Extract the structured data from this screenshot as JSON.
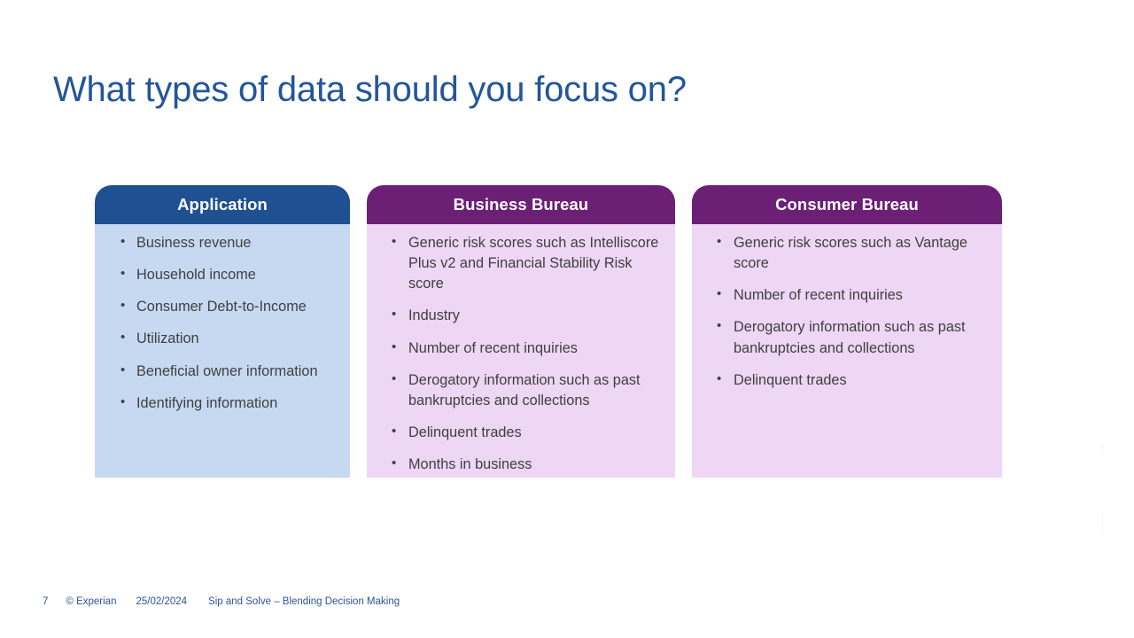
{
  "slide": {
    "title": "What types of data should you focus on?",
    "background": "#FFFFFF",
    "title_color": "#22559C"
  },
  "cards": [
    {
      "id": "application",
      "header": "Application",
      "header_color": "#1F5091",
      "body_color": "#C6D9F1",
      "bullets": [
        "Business revenue",
        "Household income",
        "Consumer Debt-to-Income",
        "Utilization",
        "Beneficial owner information",
        "Identifying information"
      ]
    },
    {
      "id": "business-bureau",
      "header": "Business Bureau",
      "header_color": "#6B2076",
      "body_color": "#EED6F5",
      "bullets": [
        "Generic risk scores such as Intelliscore Plus v2 and Financial Stability Risk score",
        "Industry",
        "Number of recent inquiries",
        "Derogatory information such as past bankruptcies and collections",
        "Delinquent trades",
        "Months in business"
      ]
    },
    {
      "id": "consumer-bureau",
      "header": "Consumer Bureau",
      "header_color": "#6B2076",
      "body_color": "#EED6F5",
      "bullets": [
        "Generic risk scores such as Vantage score",
        "Number of recent inquiries",
        "Derogatory information such as past bankruptcies and collections",
        "Delinquent trades"
      ]
    }
  ],
  "footer": {
    "page_number": "7",
    "copyright": "© Experian",
    "date": "25/02/2024",
    "deck_name": "Sip and Solve – Blending Decision Making",
    "color": "#2B5597"
  }
}
